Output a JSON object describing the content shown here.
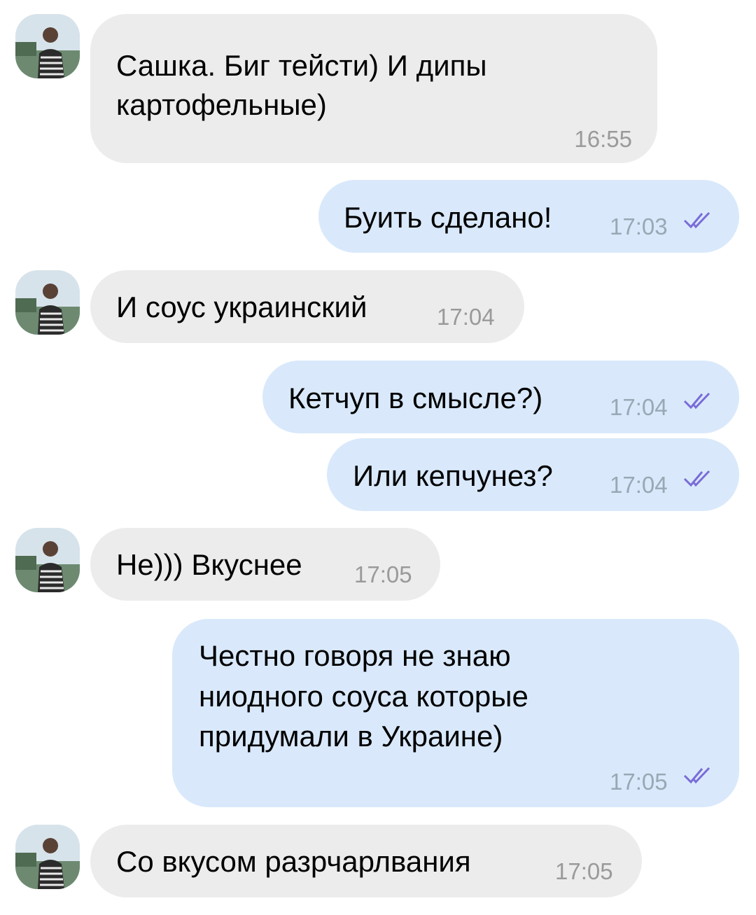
{
  "messages": [
    {
      "direction": "in",
      "text_lines": [
        "Сашка. Биг тейсти) И дипы",
        "картофельные)"
      ],
      "time": "16:55"
    },
    {
      "direction": "out",
      "text": "Буить сделано!",
      "time": "17:03",
      "read": true
    },
    {
      "direction": "in",
      "text": "И соус украинский",
      "time": "17:04"
    },
    {
      "direction": "out",
      "text": "Кетчуп в смысле?)",
      "time": "17:04",
      "read": true
    },
    {
      "direction": "out",
      "text": "Или кепчунез?",
      "time": "17:04",
      "read": true
    },
    {
      "direction": "in",
      "text": "Не))) Вкуснее",
      "time": "17:05"
    },
    {
      "direction": "out",
      "text_lines": [
        "Честно говоря не знаю",
        "ниодного соуса которые",
        "придумали в Украине)"
      ],
      "time": "17:05",
      "read": true
    },
    {
      "direction": "in",
      "text": "Со вкусом разрчарлвания",
      "time": "17:05"
    }
  ],
  "colors": {
    "incoming_bubble": "#ececec",
    "outgoing_bubble": "#d9e9fb",
    "read_check": "#7a6cd8",
    "timestamp": "#9a9a9a"
  },
  "icons": {
    "avatar": "contact-avatar-photo",
    "read_receipt": "double-check-icon"
  }
}
